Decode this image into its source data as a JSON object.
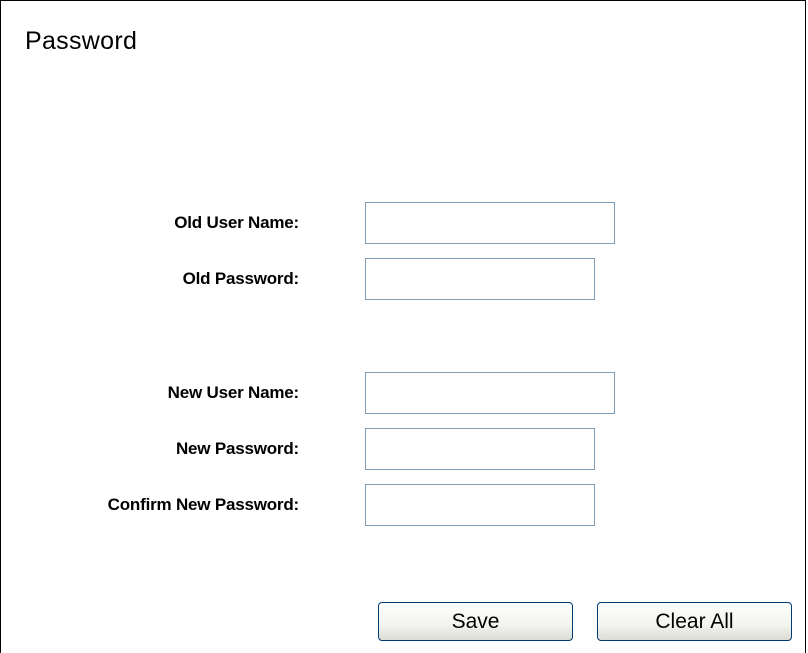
{
  "title": "Password",
  "old_section": {
    "user_name": {
      "label": "Old User Name:",
      "value": ""
    },
    "password": {
      "label": "Old Password:",
      "value": ""
    }
  },
  "new_section": {
    "user_name": {
      "label": "New User Name:",
      "value": ""
    },
    "password": {
      "label": "New Password:",
      "value": ""
    },
    "confirm_password": {
      "label": "Confirm New Password:",
      "value": ""
    }
  },
  "buttons": {
    "save": "Save",
    "clear_all": "Clear All"
  }
}
